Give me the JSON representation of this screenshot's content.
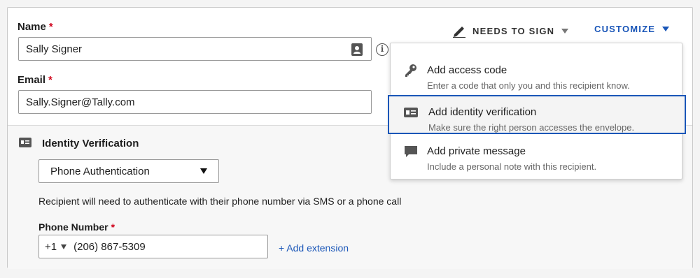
{
  "recipient": {
    "name_label": "Name",
    "required_marker": "*",
    "name_value": "Sally Signer",
    "email_label": "Email",
    "email_value": "Sally.Signer@Tally.com"
  },
  "toolbar": {
    "action_label": "NEEDS TO SIGN",
    "customize_label": "CUSTOMIZE"
  },
  "customize_menu": {
    "items": [
      {
        "title": "Add access code",
        "description": "Enter a code that only you and this recipient know.",
        "icon": "key-icon"
      },
      {
        "title": "Add identity verification",
        "description": "Make sure the right person accesses the envelope.",
        "icon": "id-card-icon"
      },
      {
        "title": "Add private message",
        "description": "Include a personal note with this recipient.",
        "icon": "speech-bubble-icon"
      }
    ],
    "selected_index": 1
  },
  "identity_verification": {
    "heading": "Identity Verification",
    "method_selected": "Phone Authentication",
    "help_text": "Recipient will need to authenticate with their phone number via SMS or a phone call",
    "phone_label": "Phone Number",
    "country_code": "+1",
    "phone_value": "(206) 867-5309",
    "add_extension_label": "+ Add extension"
  },
  "colors": {
    "accent": "#1a56b8",
    "required": "#d0021b"
  }
}
